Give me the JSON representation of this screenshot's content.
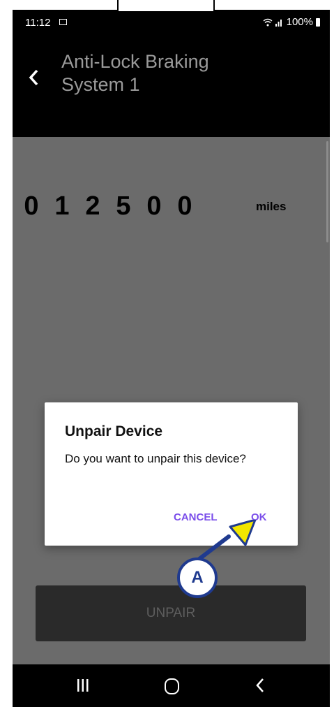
{
  "status_bar": {
    "time": "11:12",
    "battery": "100%"
  },
  "header": {
    "title": "Anti-Lock Braking System 1"
  },
  "odometer": {
    "digits": [
      "0",
      "1",
      "2",
      "5",
      "0",
      "0"
    ],
    "unit": "miles"
  },
  "dialog": {
    "title": "Unpair Device",
    "message": "Do you want to unpair this device?",
    "cancel_label": "CANCEL",
    "ok_label": "OK"
  },
  "callout": {
    "label": "A"
  },
  "unpair_button": {
    "label": "UNPAIR"
  },
  "colors": {
    "accent": "#7a4dea",
    "callout_blue": "#1f3a8f",
    "callout_yellow": "#f2e600"
  },
  "icons": [
    "message-icon",
    "wifi-icon",
    "signal-icon",
    "battery-icon",
    "back-arrow-icon",
    "recents-icon",
    "home-icon",
    "nav-back-icon"
  ]
}
